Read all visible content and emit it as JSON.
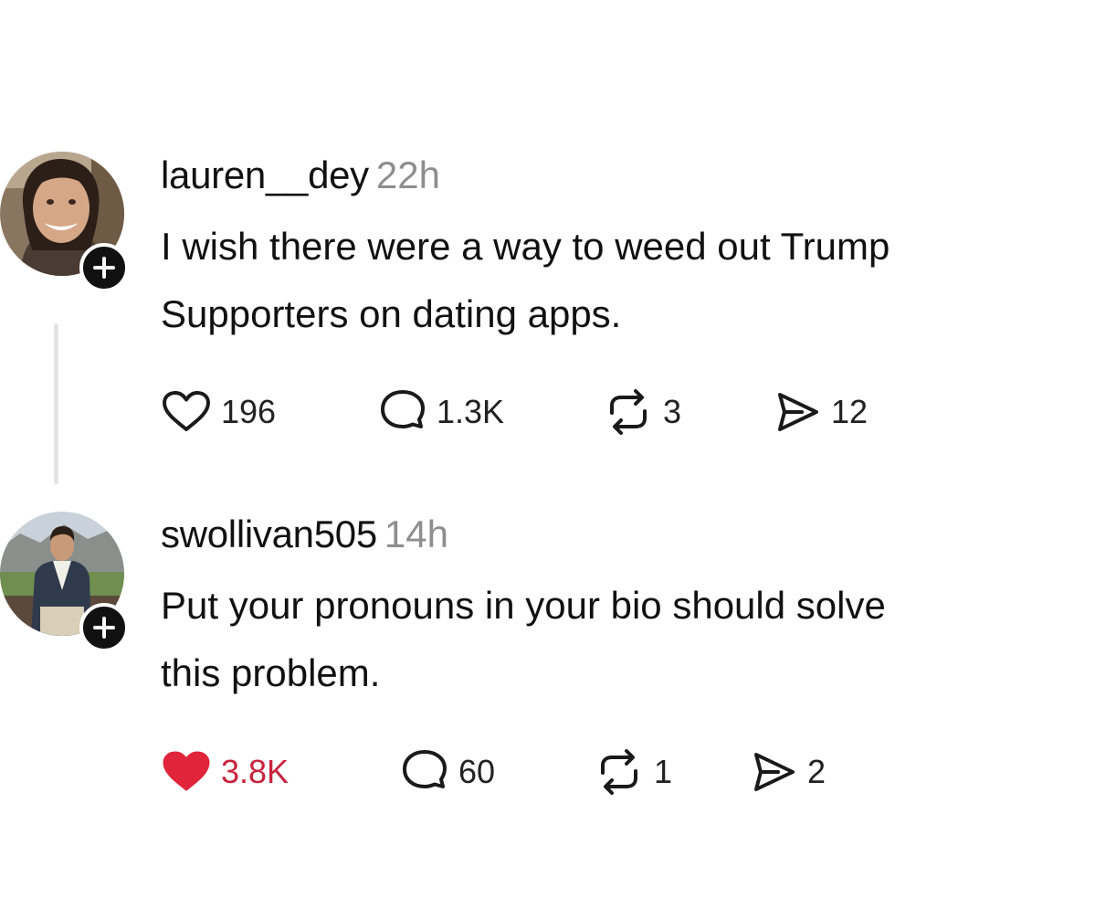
{
  "posts": [
    {
      "username": "lauren__dey",
      "time": "22h",
      "text": "I wish there were a way to weed out Trump\nSupporters on dating apps.",
      "likes": "196",
      "liked": false,
      "replies": "1.3K",
      "reposts": "3",
      "shares": "12"
    },
    {
      "username": "swollivan505",
      "time": "14h",
      "text": "Put your pronouns in your bio should solve\nthis problem.",
      "likes": "3.8K",
      "liked": true,
      "replies": "60",
      "reposts": "1",
      "shares": "2"
    }
  ],
  "colors": {
    "liked_heart": "#e0243a",
    "liked_count": "#c8243e",
    "timestamp": "#8e8e8e",
    "thread_line": "#e3e3e3"
  },
  "icons": [
    "plus-icon",
    "heart-icon",
    "comment-icon",
    "repost-icon",
    "share-icon"
  ]
}
